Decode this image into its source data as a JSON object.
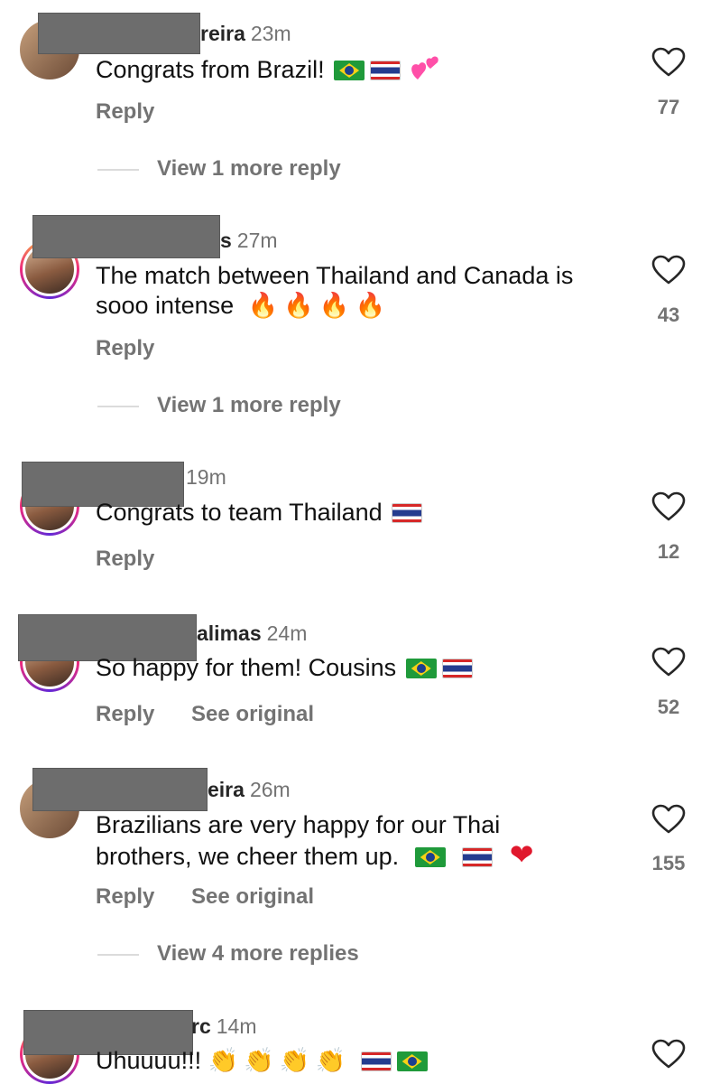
{
  "comments": [
    {
      "username_suffix": "reira",
      "time": "23m",
      "text": "Congrats from Brazil!",
      "emojis": [
        "brazil-flag",
        "thailand-flag",
        "two-hearts"
      ],
      "likes": "77",
      "actions": [
        "Reply"
      ],
      "more_replies": "View 1 more reply"
    },
    {
      "username_suffix": "s",
      "time": "27m",
      "text_line1": "The match between Thailand and Canada is",
      "text_line2": "sooo intense",
      "emojis": [
        "fire",
        "fire",
        "fire",
        "fire"
      ],
      "fire_glyph": "🔥🔥🔥🔥",
      "likes": "43",
      "actions": [
        "Reply"
      ],
      "more_replies": "View 1 more reply"
    },
    {
      "username_suffix": "",
      "time": "19m",
      "text": "Congrats to team Thailand",
      "emojis": [
        "thailand-flag"
      ],
      "likes": "12",
      "actions": [
        "Reply"
      ]
    },
    {
      "username_suffix": "alimas",
      "time": "24m",
      "text": "So happy for them! Cousins",
      "emojis": [
        "brazil-flag",
        "thailand-flag"
      ],
      "likes": "52",
      "actions": [
        "Reply",
        "See original"
      ]
    },
    {
      "username_suffix": "eira",
      "time": "26m",
      "text_line1": "Brazilians are very happy for our Thai",
      "text_line2": "brothers, we cheer them up.",
      "emojis": [
        "brazil-flag",
        "thailand-flag",
        "red-heart"
      ],
      "heart_glyph": "❤",
      "likes": "155",
      "actions": [
        "Reply",
        "See original"
      ],
      "more_replies": "View 4 more replies"
    },
    {
      "username_suffix": "rc",
      "time": "14m",
      "text": "Uhuuuu!!!",
      "emojis": [
        "clap",
        "clap",
        "clap",
        "clap",
        "thailand-flag",
        "brazil-flag"
      ],
      "clap_glyph": "👏👏👏👏"
    }
  ],
  "colors": {
    "text": "#111111",
    "muted": "#737373",
    "redaction": "#6d6d6d",
    "heart_red": "#e0182d"
  }
}
